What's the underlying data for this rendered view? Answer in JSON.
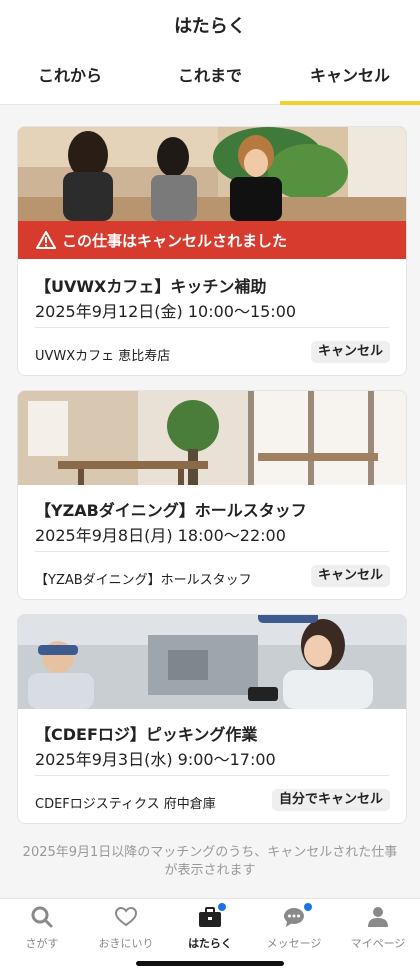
{
  "header": {
    "title": "はたらく",
    "tabs": [
      {
        "label": "これから"
      },
      {
        "label": "これまで"
      },
      {
        "label": "キャンセル"
      }
    ]
  },
  "jobs": [
    {
      "alert": "この仕事はキャンセルされました",
      "title": "【UVWXカフェ】キッチン補助",
      "date": "2025年9月12日(金) 10:00〜15:00",
      "company": "UVWXカフェ 恵比寿店",
      "status": "キャンセル"
    },
    {
      "title": "【YZABダイニング】ホールスタッフ",
      "date": "2025年9月8日(月) 18:00〜22:00",
      "company": "【YZABダイニング】ホールスタッフ",
      "status": "キャンセル"
    },
    {
      "title": "【CDEFロジ】ピッキング作業",
      "date": "2025年9月3日(水) 9:00〜17:00",
      "company": "CDEFロジスティクス 府中倉庫",
      "status": "自分でキャンセル"
    }
  ],
  "footnote": "2025年9月1日以降のマッチングのうち、キャンセルされた仕事が表示されます",
  "nav": [
    {
      "label": "さがす",
      "icon": "search-icon"
    },
    {
      "label": "おきにいり",
      "icon": "heart-icon"
    },
    {
      "label": "はたらく",
      "icon": "briefcase-icon"
    },
    {
      "label": "メッセージ",
      "icon": "chat-icon"
    },
    {
      "label": "マイページ",
      "icon": "person-icon"
    }
  ],
  "colors": {
    "accent": "#f2d12a",
    "alert": "#d63b2e",
    "notify": "#1a73e8"
  }
}
